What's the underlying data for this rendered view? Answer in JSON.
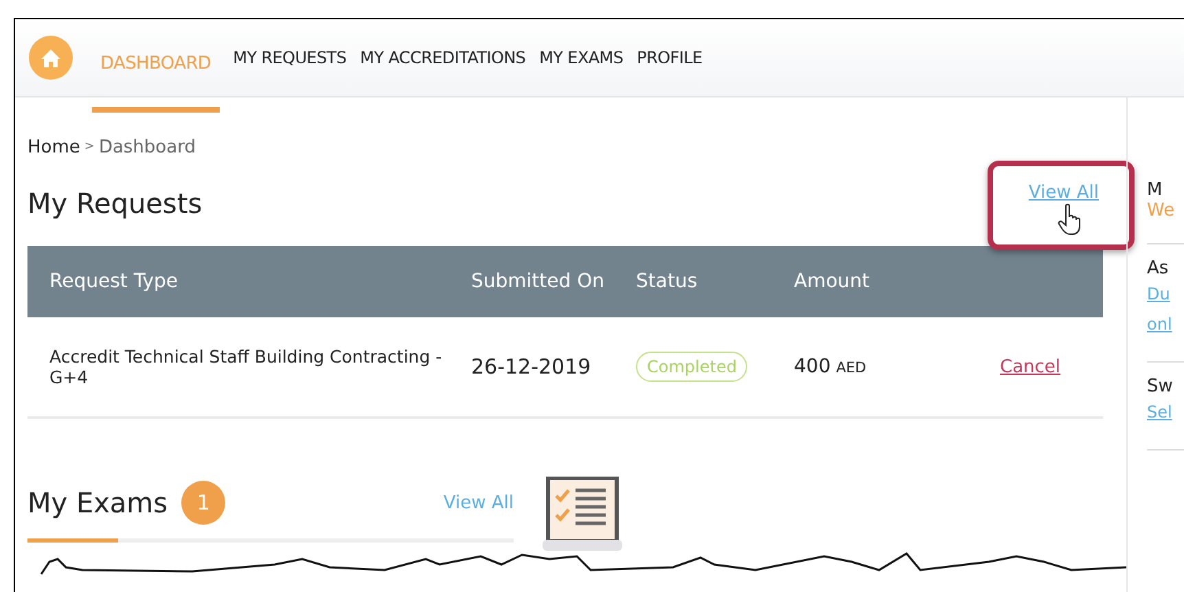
{
  "nav": {
    "items": [
      {
        "label": "DASHBOARD",
        "selected": true
      },
      {
        "label": "MY REQUESTS",
        "selected": false
      },
      {
        "label": "MY ACCREDITATIONS",
        "selected": false
      },
      {
        "label": "MY EXAMS",
        "selected": false
      },
      {
        "label": "PROFILE",
        "selected": false
      }
    ]
  },
  "breadcrumb": {
    "home": "Home",
    "separator": ">",
    "current": "Dashboard"
  },
  "requests": {
    "title": "My Requests",
    "view_all": {
      "label": "View All",
      "highlighted": true
    },
    "table": {
      "columns": [
        "Request Type",
        "Submitted On",
        "Status",
        "Amount"
      ],
      "rows": [
        {
          "request_type": "Accredit Technical Staff Building Contracting -G+4",
          "submitted_on": "26-12-2019",
          "status": {
            "label": "Completed",
            "kind": "completed"
          },
          "amount": "400",
          "currency": "AED",
          "action": "Cancel"
        }
      ]
    }
  },
  "exams": {
    "title": "My Exams",
    "count": "1",
    "view_all": "View All"
  },
  "sidebar": {
    "items": [
      {
        "title": "M",
        "lines": [
          {
            "text": "We",
            "kind": "accent"
          }
        ]
      },
      {
        "title": "As",
        "lines": [
          {
            "text": "Du",
            "kind": "link"
          },
          {
            "text": "onl",
            "kind": "link"
          }
        ]
      },
      {
        "title": "Sw",
        "lines": [
          {
            "text": "Sel",
            "kind": "link"
          }
        ]
      }
    ]
  }
}
